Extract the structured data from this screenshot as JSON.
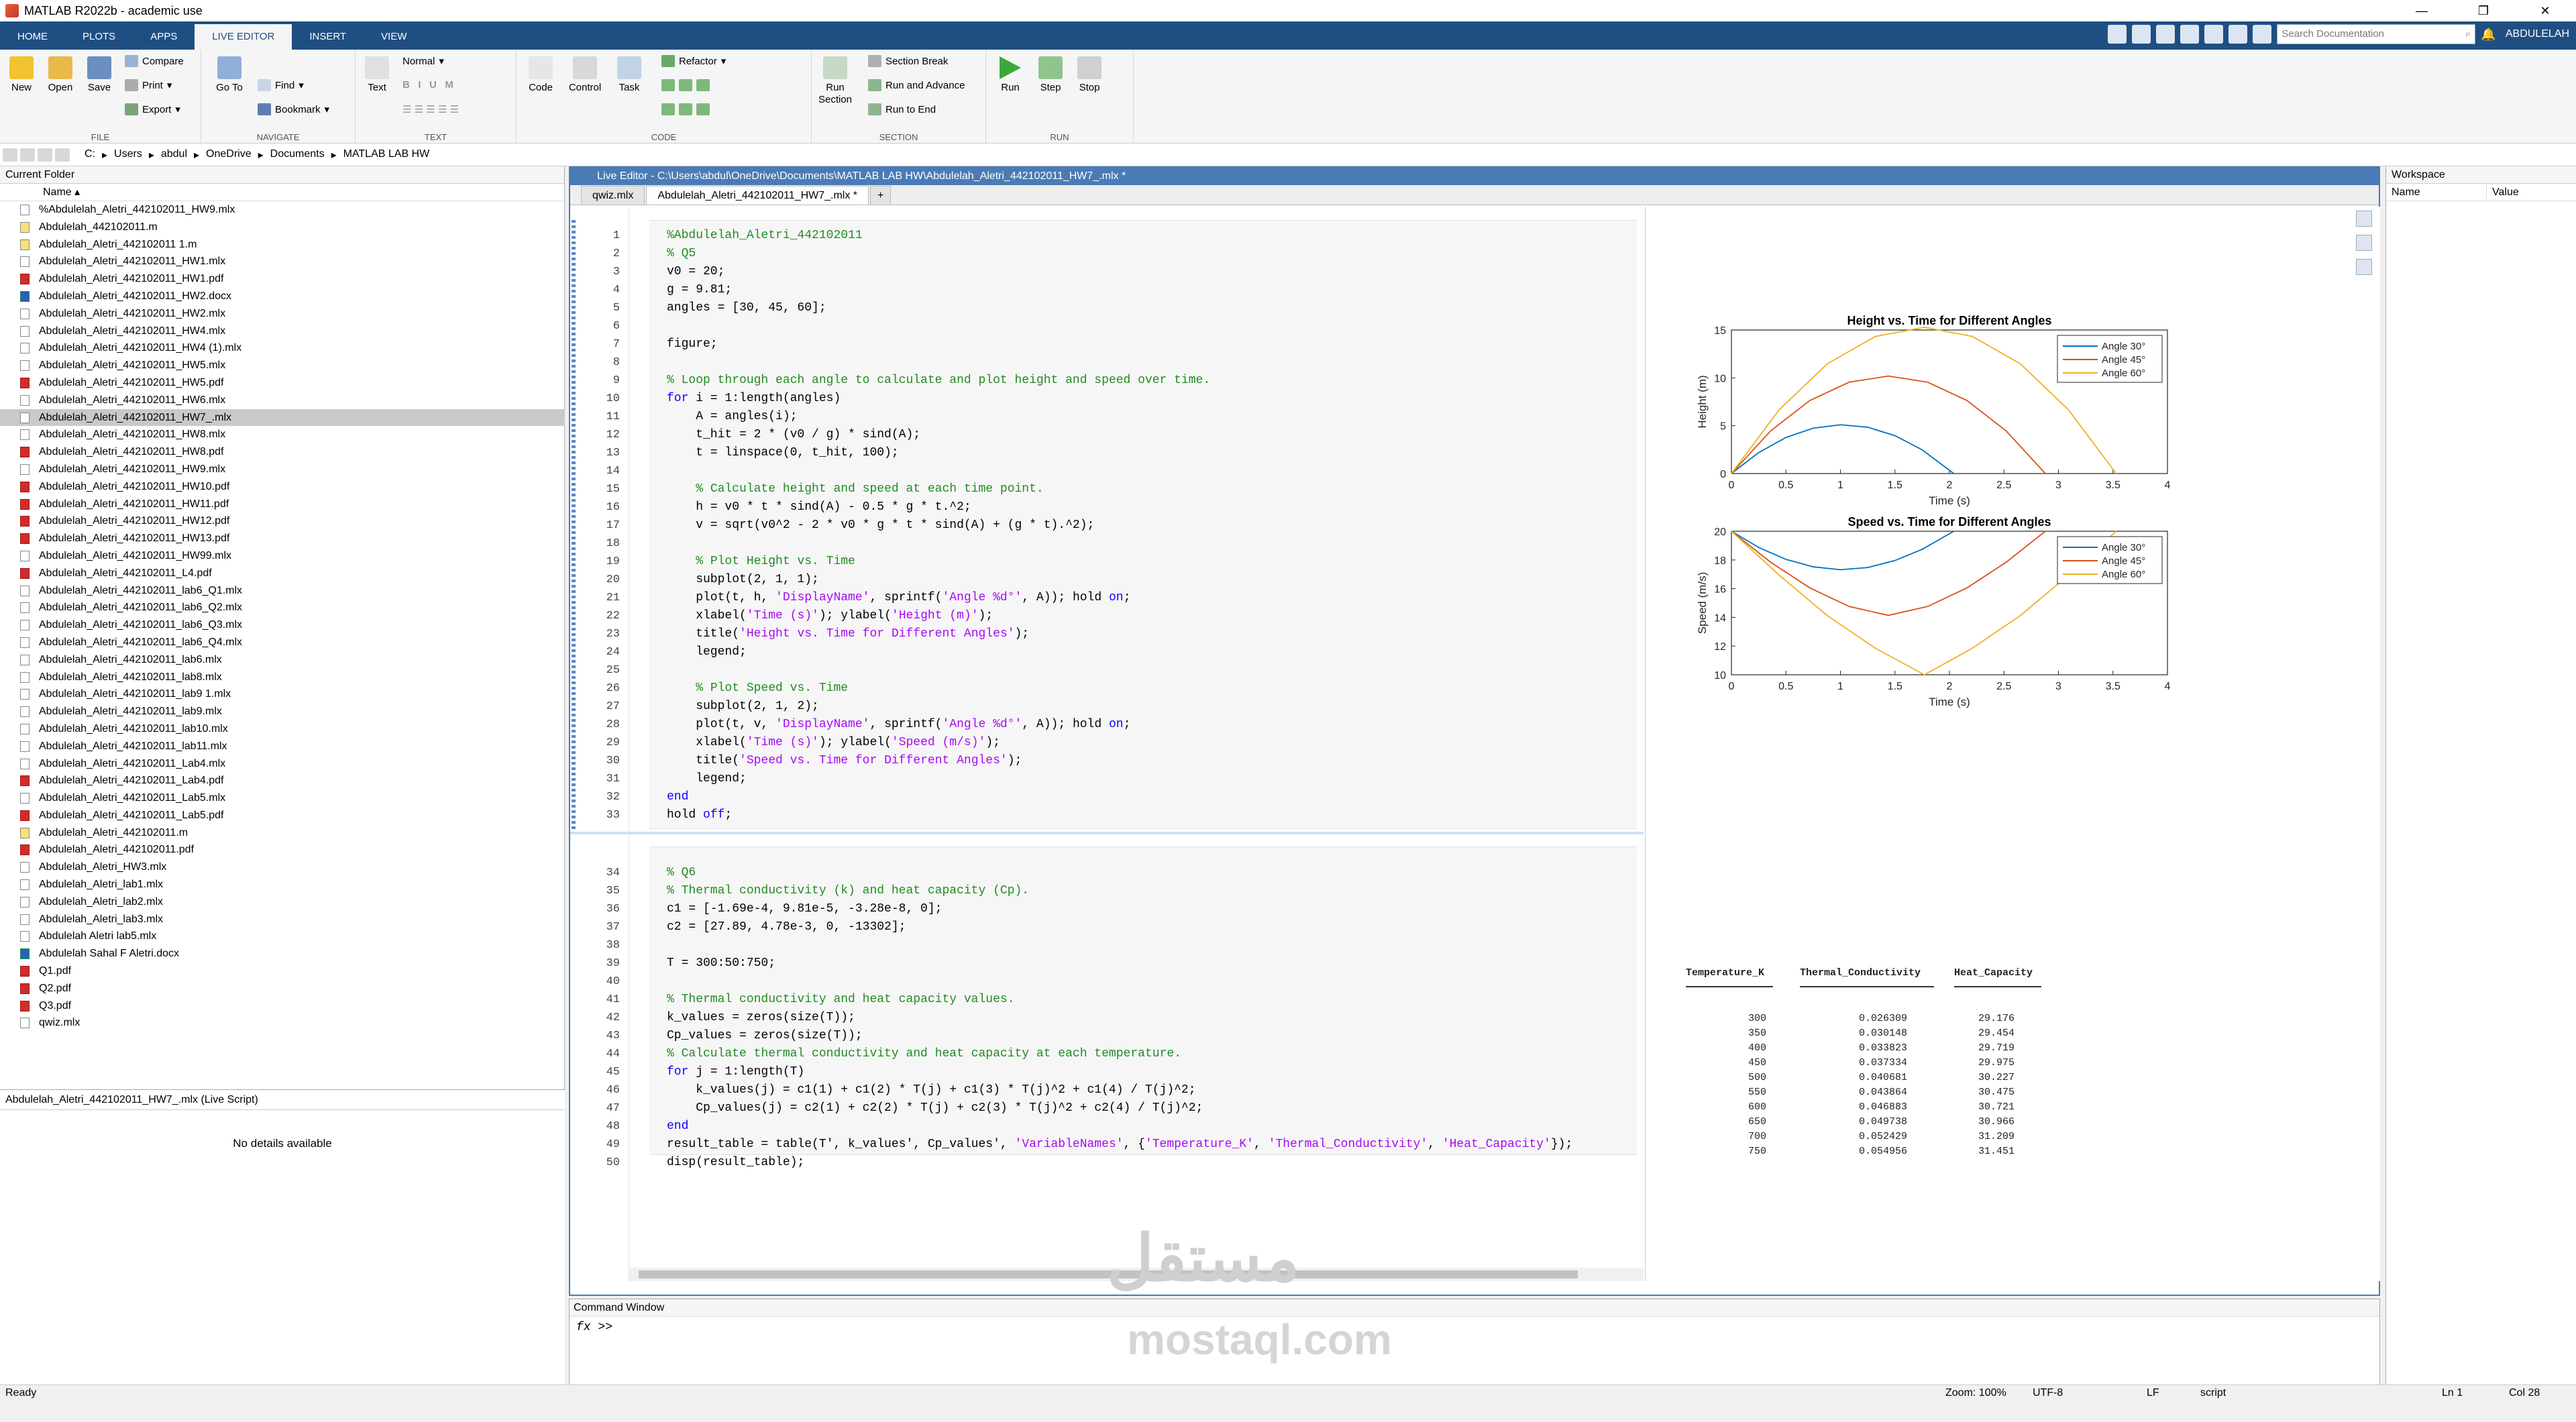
{
  "window": {
    "title": "MATLAB R2022b - academic use"
  },
  "tabs": [
    "HOME",
    "PLOTS",
    "APPS",
    "LIVE EDITOR",
    "INSERT",
    "VIEW"
  ],
  "search": {
    "placeholder": "Search Documentation"
  },
  "user": "ABDULELAH",
  "ribbon": {
    "file": {
      "label": "FILE",
      "new": "New",
      "open": "Open",
      "save": "Save",
      "compare": "Compare",
      "print": "Print",
      "export": "Export"
    },
    "navigate": {
      "label": "NAVIGATE",
      "goto": "Go To",
      "find": "Find",
      "bookmark": "Bookmark"
    },
    "text": {
      "label": "TEXT",
      "text": "Text",
      "style": "Normal"
    },
    "code": {
      "label": "CODE",
      "code": "Code",
      "control": "Control",
      "task": "Task",
      "refactor": "Refactor"
    },
    "section": {
      "label": "SECTION",
      "run_section": "Run\nSection",
      "section_break": "Section Break",
      "run_advance": "Run and Advance",
      "run_end": "Run to End"
    },
    "run": {
      "label": "RUN",
      "run": "Run",
      "step": "Step",
      "stop": "Stop"
    }
  },
  "address": {
    "crumbs": [
      "C:",
      "Users",
      "abdul",
      "OneDrive",
      "Documents",
      "MATLAB LAB HW"
    ]
  },
  "current_folder": {
    "title": "Current Folder",
    "col_name": "Name",
    "files": [
      {
        "name": "%Abdulelah_Aletri_442102011_HW9.mlx",
        "type": "mlx"
      },
      {
        "name": "Abdulelah_442102011.m",
        "type": "m"
      },
      {
        "name": "Abdulelah_Aletri_442102011 1.m",
        "type": "m"
      },
      {
        "name": "Abdulelah_Aletri_442102011_HW1.mlx",
        "type": "mlx"
      },
      {
        "name": "Abdulelah_Aletri_442102011_HW1.pdf",
        "type": "pdf"
      },
      {
        "name": "Abdulelah_Aletri_442102011_HW2.docx",
        "type": "doc"
      },
      {
        "name": "Abdulelah_Aletri_442102011_HW2.mlx",
        "type": "mlx"
      },
      {
        "name": "Abdulelah_Aletri_442102011_HW4.mlx",
        "type": "mlx"
      },
      {
        "name": "Abdulelah_Aletri_442102011_HW4 (1).mlx",
        "type": "mlx"
      },
      {
        "name": "Abdulelah_Aletri_442102011_HW5.mlx",
        "type": "mlx"
      },
      {
        "name": "Abdulelah_Aletri_442102011_HW5.pdf",
        "type": "pdf"
      },
      {
        "name": "Abdulelah_Aletri_442102011_HW6.mlx",
        "type": "mlx"
      },
      {
        "name": "Abdulelah_Aletri_442102011_HW7_.mlx",
        "type": "mlx",
        "selected": true
      },
      {
        "name": "Abdulelah_Aletri_442102011_HW8.mlx",
        "type": "mlx"
      },
      {
        "name": "Abdulelah_Aletri_442102011_HW8.pdf",
        "type": "pdf"
      },
      {
        "name": "Abdulelah_Aletri_442102011_HW9.mlx",
        "type": "mlx"
      },
      {
        "name": "Abdulelah_Aletri_442102011_HW10.pdf",
        "type": "pdf"
      },
      {
        "name": "Abdulelah_Aletri_442102011_HW11.pdf",
        "type": "pdf"
      },
      {
        "name": "Abdulelah_Aletri_442102011_HW12.pdf",
        "type": "pdf"
      },
      {
        "name": "Abdulelah_Aletri_442102011_HW13.pdf",
        "type": "pdf"
      },
      {
        "name": "Abdulelah_Aletri_442102011_HW99.mlx",
        "type": "mlx"
      },
      {
        "name": "Abdulelah_Aletri_442102011_L4.pdf",
        "type": "pdf"
      },
      {
        "name": "Abdulelah_Aletri_442102011_lab6_Q1.mlx",
        "type": "mlx"
      },
      {
        "name": "Abdulelah_Aletri_442102011_lab6_Q2.mlx",
        "type": "mlx"
      },
      {
        "name": "Abdulelah_Aletri_442102011_lab6_Q3.mlx",
        "type": "mlx"
      },
      {
        "name": "Abdulelah_Aletri_442102011_lab6_Q4.mlx",
        "type": "mlx"
      },
      {
        "name": "Abdulelah_Aletri_442102011_lab6.mlx",
        "type": "mlx"
      },
      {
        "name": "Abdulelah_Aletri_442102011_lab8.mlx",
        "type": "mlx"
      },
      {
        "name": "Abdulelah_Aletri_442102011_lab9 1.mlx",
        "type": "mlx"
      },
      {
        "name": "Abdulelah_Aletri_442102011_lab9.mlx",
        "type": "mlx"
      },
      {
        "name": "Abdulelah_Aletri_442102011_lab10.mlx",
        "type": "mlx"
      },
      {
        "name": "Abdulelah_Aletri_442102011_lab11.mlx",
        "type": "mlx"
      },
      {
        "name": "Abdulelah_Aletri_442102011_Lab4.mlx",
        "type": "mlx"
      },
      {
        "name": "Abdulelah_Aletri_442102011_Lab4.pdf",
        "type": "pdf"
      },
      {
        "name": "Abdulelah_Aletri_442102011_Lab5.mlx",
        "type": "mlx"
      },
      {
        "name": "Abdulelah_Aletri_442102011_Lab5.pdf",
        "type": "pdf"
      },
      {
        "name": "Abdulelah_Aletri_442102011.m",
        "type": "m"
      },
      {
        "name": "Abdulelah_Aletri_442102011.pdf",
        "type": "pdf"
      },
      {
        "name": "Abdulelah_Aletri_HW3.mlx",
        "type": "mlx"
      },
      {
        "name": "Abdulelah_Aletri_lab1.mlx",
        "type": "mlx"
      },
      {
        "name": "Abdulelah_Aletri_lab2.mlx",
        "type": "mlx"
      },
      {
        "name": "Abdulelah_Aletri_lab3.mlx",
        "type": "mlx"
      },
      {
        "name": "Abdulelah Aletri lab5.mlx",
        "type": "mlx"
      },
      {
        "name": "Abdulelah Sahal F Aletri.docx",
        "type": "doc"
      },
      {
        "name": "Q1.pdf",
        "type": "pdf"
      },
      {
        "name": "Q2.pdf",
        "type": "pdf"
      },
      {
        "name": "Q3.pdf",
        "type": "pdf"
      },
      {
        "name": "qwiz.mlx",
        "type": "mlx"
      }
    ]
  },
  "details": {
    "title": "Abdulelah_Aletri_442102011_HW7_.mlx  (Live Script)",
    "empty": "No details available"
  },
  "editor": {
    "title": "Live Editor - C:\\Users\\abdul\\OneDrive\\Documents\\MATLAB LAB HW\\Abdulelah_Aletri_442102011_HW7_.mlx *",
    "tabs": [
      "qwiz.mlx",
      "Abdulelah_Aletri_442102011_HW7_.mlx *",
      "+"
    ]
  },
  "code": [
    {
      "n": "1",
      "html": "<span class=\"cm\">%Abdulelah_Aletri_442102011</span>"
    },
    {
      "n": "2",
      "html": "<span class=\"cm\">% Q5</span>"
    },
    {
      "n": "3",
      "html": "v0 = 20;"
    },
    {
      "n": "4",
      "html": "g = 9.81;"
    },
    {
      "n": "5",
      "html": "angles = [30, 45, 60];"
    },
    {
      "n": "6",
      "html": ""
    },
    {
      "n": "7",
      "html": "figure;"
    },
    {
      "n": "8",
      "html": ""
    },
    {
      "n": "9",
      "html": "<span class=\"cm\">% Loop through each angle to calculate and plot height and speed over time.</span>"
    },
    {
      "n": "10",
      "html": "<span class=\"kw\">for</span> i = 1:length(angles)"
    },
    {
      "n": "11",
      "html": "    A = angles(i);"
    },
    {
      "n": "12",
      "html": "    t_hit = 2 * (v0 / g) * sind(A);"
    },
    {
      "n": "13",
      "html": "    t = linspace(0, t_hit, 100);"
    },
    {
      "n": "14",
      "html": ""
    },
    {
      "n": "15",
      "html": "    <span class=\"cm\">% Calculate height and speed at each time point.</span>"
    },
    {
      "n": "16",
      "html": "    h = v0 * t * sind(A) - 0.5 * g * t.^2;"
    },
    {
      "n": "17",
      "html": "    v = sqrt(v0^2 - 2 * v0 * g * t * sind(A) + (g * t).^2);"
    },
    {
      "n": "18",
      "html": ""
    },
    {
      "n": "19",
      "html": "    <span class=\"cm\">% Plot Height vs. Time</span>"
    },
    {
      "n": "20",
      "html": "    subplot(2, 1, 1);"
    },
    {
      "n": "21",
      "html": "    plot(t, h, <span class=\"st\">'DisplayName'</span>, sprintf(<span class=\"st\">'Angle %d°'</span>, A)); hold <span class=\"kw\">on</span>;"
    },
    {
      "n": "22",
      "html": "    xlabel(<span class=\"st\">'Time (s)'</span>); ylabel(<span class=\"st\">'Height (m)'</span>);"
    },
    {
      "n": "23",
      "html": "    title(<span class=\"st\">'Height vs. Time for Different Angles'</span>);"
    },
    {
      "n": "24",
      "html": "    legend;"
    },
    {
      "n": "25",
      "html": ""
    },
    {
      "n": "26",
      "html": "    <span class=\"cm\">% Plot Speed vs. Time</span>"
    },
    {
      "n": "27",
      "html": "    subplot(2, 1, 2);"
    },
    {
      "n": "28",
      "html": "    plot(t, v, <span class=\"st\">'DisplayName'</span>, sprintf(<span class=\"st\">'Angle %d°'</span>, A)); hold <span class=\"kw\">on</span>;"
    },
    {
      "n": "29",
      "html": "    xlabel(<span class=\"st\">'Time (s)'</span>); ylabel(<span class=\"st\">'Speed (m/s)'</span>);"
    },
    {
      "n": "30",
      "html": "    title(<span class=\"st\">'Speed vs. Time for Different Angles'</span>);"
    },
    {
      "n": "31",
      "html": "    legend;"
    },
    {
      "n": "32",
      "html": "<span class=\"kw\">end</span>"
    },
    {
      "n": "33",
      "html": "hold <span class=\"kw\">off</span>;"
    },
    {
      "n": "34",
      "html": "<span class=\"cm\">% Q6</span>"
    },
    {
      "n": "35",
      "html": "<span class=\"cm\">% Thermal conductivity (k) and heat capacity (Cp).</span>"
    },
    {
      "n": "36",
      "html": "c1 = [-1.69e-4, 9.81e-5, -3.28e-8, 0];"
    },
    {
      "n": "37",
      "html": "c2 = [27.89, 4.78e-3, 0, -13302];"
    },
    {
      "n": "38",
      "html": ""
    },
    {
      "n": "39",
      "html": "T = 300:50:750;"
    },
    {
      "n": "40",
      "html": ""
    },
    {
      "n": "41",
      "html": "<span class=\"cm\">% Thermal conductivity and heat capacity values.</span>"
    },
    {
      "n": "42",
      "html": "k_values = zeros(size(T));"
    },
    {
      "n": "43",
      "html": "Cp_values = zeros(size(T));"
    },
    {
      "n": "44",
      "html": "<span class=\"cm\">% Calculate thermal conductivity and heat capacity at each temperature.</span>"
    },
    {
      "n": "45",
      "html": "<span class=\"kw\">for</span> j = 1:length(T)"
    },
    {
      "n": "46",
      "html": "    k_values(j) = c1(1) + c1(2) * T(j) + c1(3) * T(j)^2 + c1(4) / T(j)^2;"
    },
    {
      "n": "47",
      "html": "    Cp_values(j) = c2(1) + c2(2) * T(j) + c2(3) * T(j)^2 + c2(4) / T(j)^2;"
    },
    {
      "n": "48",
      "html": "<span class=\"kw\">end</span>"
    },
    {
      "n": "49",
      "html": "result_table = table(T', k_values', Cp_values', <span class=\"st\">'VariableNames'</span>, {<span class=\"st\">'Temperature_K'</span>, <span class=\"st\">'Thermal_Conductivity'</span>, <span class=\"st\">'Heat_Capacity'</span>});"
    },
    {
      "n": "50",
      "html": "disp(result_table);"
    }
  ],
  "chart_data": [
    {
      "type": "line",
      "title": "Height vs. Time for Different Angles",
      "xlabel": "Time (s)",
      "ylabel": "Height (m)",
      "xlim": [
        0,
        4
      ],
      "ylim": [
        0,
        15
      ],
      "xticks": [
        "0",
        "0.5",
        "1",
        "1.5",
        "2",
        "2.5",
        "3",
        "3.5",
        "4"
      ],
      "yticks": [
        "0",
        "5",
        "10",
        "15"
      ],
      "legend_position": "top-right",
      "series": [
        {
          "name": "Angle 30°",
          "color": "#0072BD",
          "x": [
            0,
            0.25,
            0.5,
            0.75,
            1.0,
            1.25,
            1.5,
            1.75,
            2.04
          ],
          "y": [
            0,
            2.19,
            3.77,
            4.74,
            5.1,
            4.84,
            3.96,
            2.48,
            0
          ]
        },
        {
          "name": "Angle 45°",
          "color": "#D95319",
          "x": [
            0,
            0.36,
            0.72,
            1.08,
            1.44,
            1.8,
            2.16,
            2.52,
            2.88
          ],
          "y": [
            0,
            4.46,
            7.64,
            9.55,
            10.19,
            9.55,
            7.64,
            4.46,
            0
          ]
        },
        {
          "name": "Angle 60°",
          "color": "#EDB120",
          "x": [
            0,
            0.44,
            0.88,
            1.32,
            1.77,
            2.21,
            2.65,
            3.09,
            3.53
          ],
          "y": [
            0,
            6.69,
            11.47,
            14.33,
            15.29,
            14.33,
            11.47,
            6.69,
            0
          ]
        }
      ]
    },
    {
      "type": "line",
      "title": "Speed vs. Time for Different Angles",
      "xlabel": "Time (s)",
      "ylabel": "Speed (m/s)",
      "xlim": [
        0,
        4
      ],
      "ylim": [
        10,
        20
      ],
      "xticks": [
        "0",
        "0.5",
        "1",
        "1.5",
        "2",
        "2.5",
        "3",
        "3.5",
        "4"
      ],
      "yticks": [
        "10",
        "12",
        "14",
        "16",
        "18",
        "20"
      ],
      "legend_position": "top-right",
      "series": [
        {
          "name": "Angle 30°",
          "color": "#0072BD",
          "x": [
            0,
            0.25,
            0.5,
            0.75,
            1.0,
            1.25,
            1.5,
            1.75,
            2.04
          ],
          "y": [
            20,
            18.87,
            18.04,
            17.52,
            17.32,
            17.47,
            17.96,
            18.74,
            20
          ]
        },
        {
          "name": "Angle 45°",
          "color": "#D95319",
          "x": [
            0,
            0.36,
            0.72,
            1.08,
            1.44,
            1.8,
            2.16,
            2.52,
            2.88
          ],
          "y": [
            20,
            17.84,
            16.05,
            14.76,
            14.14,
            14.76,
            16.05,
            17.84,
            20
          ]
        },
        {
          "name": "Angle 60°",
          "color": "#EDB120",
          "x": [
            0,
            0.44,
            0.88,
            1.32,
            1.77,
            2.21,
            2.65,
            3.09,
            3.53
          ],
          "y": [
            20,
            16.93,
            14.12,
            11.85,
            10.0,
            11.85,
            14.12,
            16.93,
            20
          ]
        }
      ]
    }
  ],
  "result_table": {
    "headers": [
      "Temperature_K",
      "Thermal_Conductivity",
      "Heat_Capacity"
    ],
    "rows": [
      [
        "300",
        "0.026309",
        "29.176"
      ],
      [
        "350",
        "0.030148",
        "29.454"
      ],
      [
        "400",
        "0.033823",
        "29.719"
      ],
      [
        "450",
        "0.037334",
        "29.975"
      ],
      [
        "500",
        "0.040681",
        "30.227"
      ],
      [
        "550",
        "0.043864",
        "30.475"
      ],
      [
        "600",
        "0.046883",
        "30.721"
      ],
      [
        "650",
        "0.049738",
        "30.966"
      ],
      [
        "700",
        "0.052429",
        "31.209"
      ],
      [
        "750",
        "0.054956",
        "31.451"
      ]
    ]
  },
  "command_window": {
    "title": "Command Window",
    "prompt": ">>"
  },
  "workspace": {
    "title": "Workspace",
    "col_name": "Name",
    "col_value": "Value"
  },
  "statusbar": {
    "ready": "Ready",
    "zoom": "Zoom: 100%",
    "encoding": "UTF-8",
    "eol": "LF",
    "type": "script",
    "ln": "Ln  1",
    "col": "Col  28"
  },
  "watermark": {
    "arabic": "مستقل",
    "latin": "mostaql.com"
  }
}
